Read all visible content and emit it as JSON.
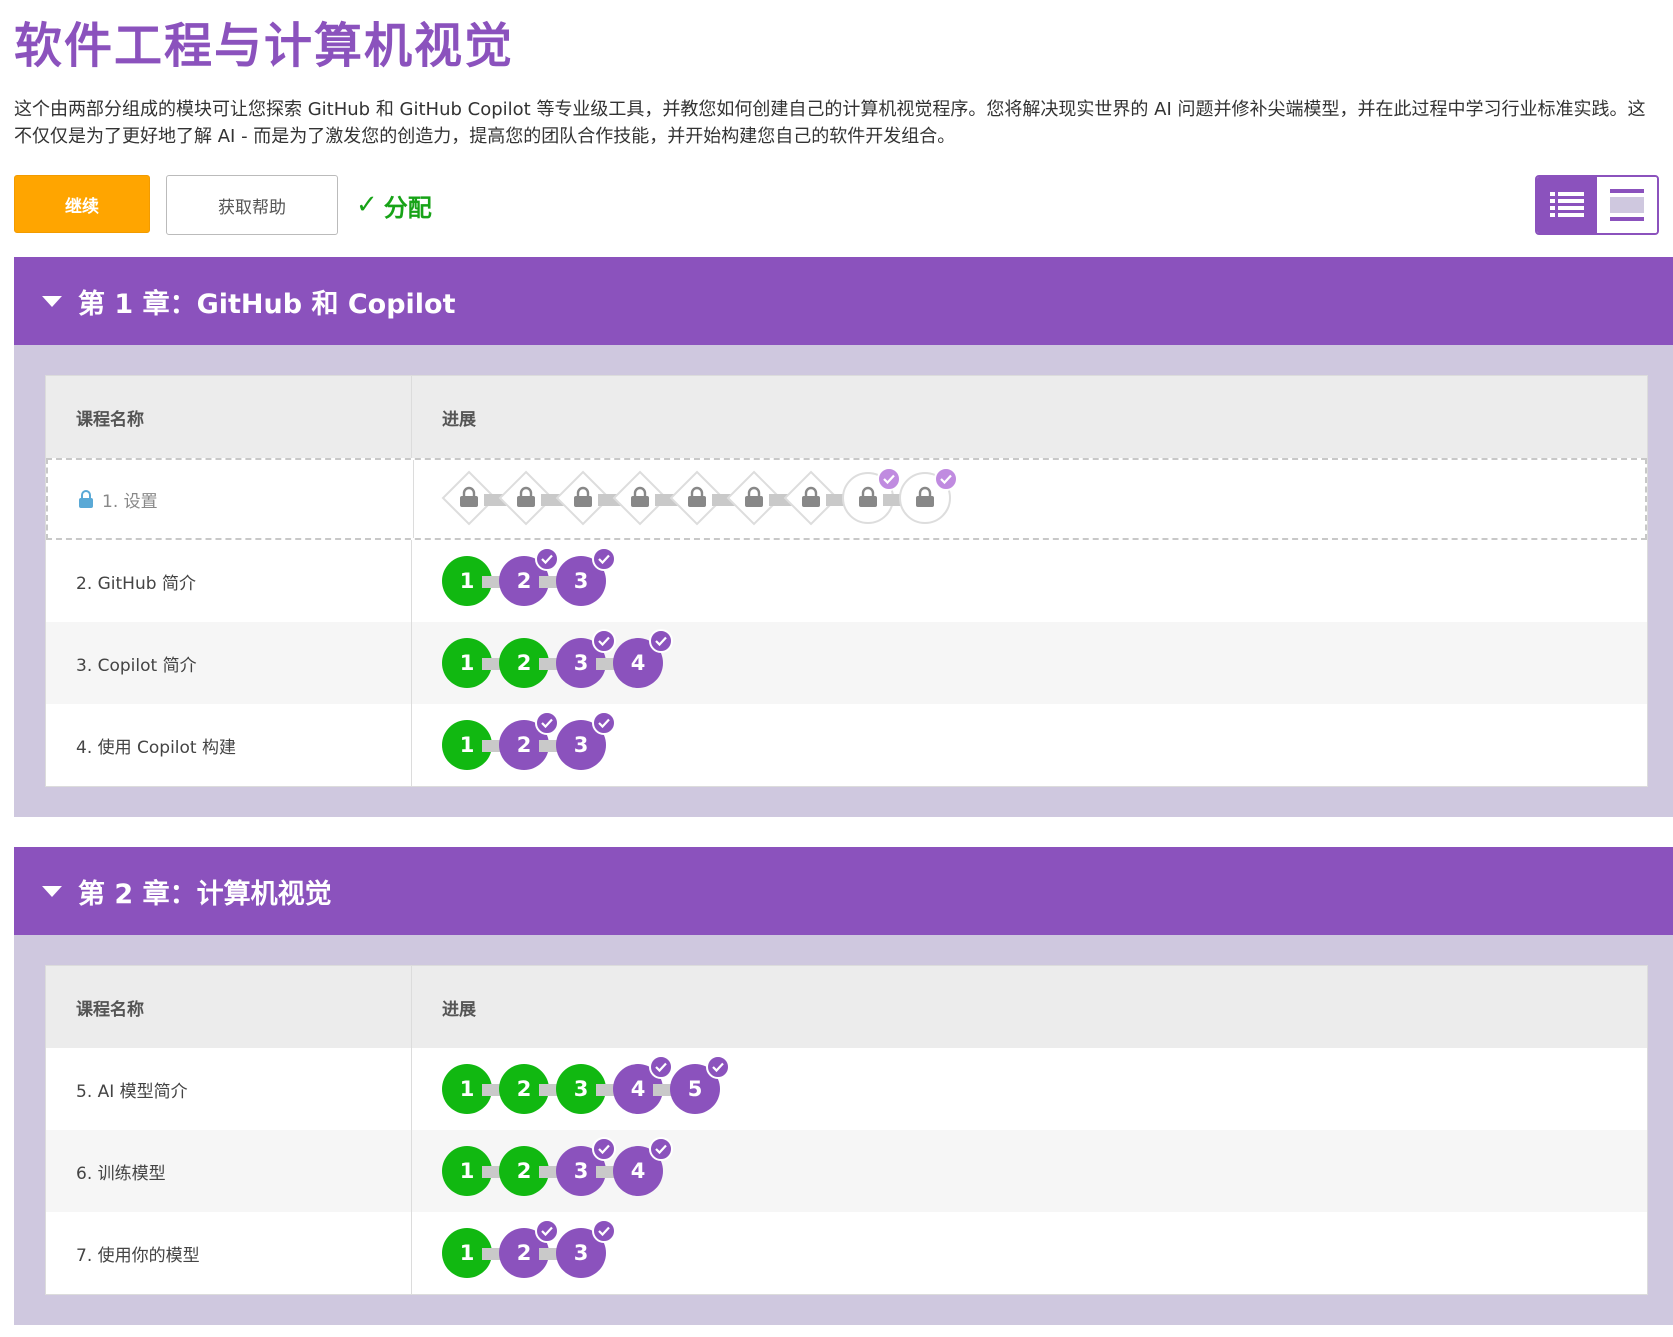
{
  "page": {
    "title": "软件工程与计算机视觉",
    "description": "这个由两部分组成的模块可让您探索 GitHub 和 GitHub Copilot 等专业级工具，并教您如何创建自己的计算机视觉程序。您将解决现实世界的 AI 问题并修补尖端模型，并在此过程中学习行业标准实践。这不仅仅是为了更好地了解 AI - 而是为了激发您的创造力，提高您的团队合作技能，并开始构建您自己的软件开发组合。"
  },
  "actions": {
    "continue_label": "继续",
    "help_label": "获取帮助",
    "assigned_label": "分配",
    "accent": "#8b52bd",
    "continue_color": "#ffa500",
    "assigned_color": "#17a317"
  },
  "chapters": [
    {
      "title": "第 1 章：GitHub 和 Copilot",
      "col_name": "课程名称",
      "col_progress": "进展",
      "lessons": [
        {
          "name": "1. 设置",
          "locked": true,
          "steps": [
            "lock",
            "lock",
            "lock",
            "lock",
            "lock",
            "lock",
            "lock",
            "lock-done",
            "lock-done"
          ]
        },
        {
          "name": "2. GitHub 简介",
          "locked": false,
          "steps": [
            {
              "n": "1",
              "s": "green"
            },
            {
              "n": "2",
              "s": "purple-check"
            },
            {
              "n": "3",
              "s": "purple-check"
            }
          ]
        },
        {
          "name": "3. Copilot 简介",
          "locked": false,
          "steps": [
            {
              "n": "1",
              "s": "green"
            },
            {
              "n": "2",
              "s": "green"
            },
            {
              "n": "3",
              "s": "purple-check"
            },
            {
              "n": "4",
              "s": "purple-check"
            }
          ]
        },
        {
          "name": "4. 使用 Copilot 构建",
          "locked": false,
          "steps": [
            {
              "n": "1",
              "s": "green"
            },
            {
              "n": "2",
              "s": "purple-check"
            },
            {
              "n": "3",
              "s": "purple-check"
            }
          ]
        }
      ]
    },
    {
      "title": "第 2 章：计算机视觉",
      "col_name": "课程名称",
      "col_progress": "进展",
      "lessons": [
        {
          "name": "5. AI 模型简介",
          "locked": false,
          "steps": [
            {
              "n": "1",
              "s": "green"
            },
            {
              "n": "2",
              "s": "green"
            },
            {
              "n": "3",
              "s": "green"
            },
            {
              "n": "4",
              "s": "purple-check"
            },
            {
              "n": "5",
              "s": "purple-check"
            }
          ]
        },
        {
          "name": "6. 训练模型",
          "locked": false,
          "steps": [
            {
              "n": "1",
              "s": "green"
            },
            {
              "n": "2",
              "s": "green"
            },
            {
              "n": "3",
              "s": "purple-check"
            },
            {
              "n": "4",
              "s": "purple-check"
            }
          ]
        },
        {
          "name": "7. 使用你的模型",
          "locked": false,
          "steps": [
            {
              "n": "1",
              "s": "green"
            },
            {
              "n": "2",
              "s": "purple-check"
            },
            {
              "n": "3",
              "s": "purple-check"
            }
          ]
        }
      ]
    }
  ]
}
